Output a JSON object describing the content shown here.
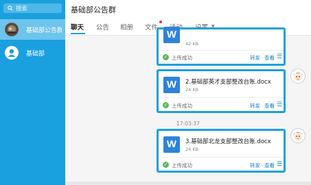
{
  "sidebar": {
    "search_placeholder": "搜索",
    "conversations": [
      {
        "name": "基础部公告群",
        "active": true
      },
      {
        "name": "基础部",
        "active": false
      }
    ]
  },
  "chat": {
    "title": "基础部公告群",
    "tabs": [
      {
        "label": "聊天",
        "active": true
      },
      {
        "label": "公告"
      },
      {
        "label": "相册"
      },
      {
        "label": "文件",
        "has_notification": true
      },
      {
        "label": "活动"
      },
      {
        "label": "设置"
      }
    ],
    "messages": [
      {
        "file_name": "",
        "file_size": "42 KB",
        "status": "上传成功",
        "forward": "转发",
        "view": "查看"
      },
      {
        "file_name": "2.基础部英才支部整改台账.docx",
        "file_size": "24 KB",
        "status": "上传成功",
        "forward": "转发",
        "view": "查看"
      },
      {
        "file_name": "3.基础部北龙支部整改台账.docx",
        "file_size": "24 KB",
        "status": "上传成功",
        "forward": "转发",
        "view": "查看"
      }
    ],
    "timestamp": "17:03:37"
  },
  "colors": {
    "accent": "#1aa0de",
    "sidebar_bg": "#1aa0de",
    "file_icon": "#2e83d9",
    "success": "#5cb85c"
  },
  "icons": {
    "search": "search-icon",
    "file": "word-file-icon",
    "menu": "menu-icon",
    "success": "check-circle-icon"
  }
}
